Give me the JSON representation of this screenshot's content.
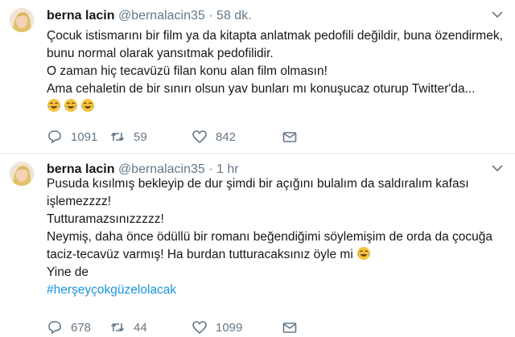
{
  "tweets": [
    {
      "name": "berna lacin",
      "handle": "@bernalacin35",
      "dot": "·",
      "time": "58 dk.",
      "lines": [
        "Çocuk istismarını bir film ya da kitapta anlatmak pedofili değildir, buna özendirmek,",
        "bunu normal olarak yansıtmak pedofilidir.",
        "O zaman hiç tecavüzü filan konu alan film olmasın!",
        "Ama cehaletin de bir sınırı olsun yav bunları mı konuşucaz oturup Twitter'da..."
      ],
      "emoji_count": 3,
      "emoji_name": "laughing-tears-emoji",
      "replies": "1091",
      "retweets": "59",
      "likes": "842"
    },
    {
      "name": "berna lacin",
      "handle": "@bernalacin35",
      "dot": "·",
      "time": "1 hr",
      "lines": [
        "Pusuda kısılmış  bekleyip de dur şimdi bir açığını bulalım da saldıralım kafası",
        "işlemezzzz!",
        "Tutturamazsınızzzzz!",
        "Neymiş, daha önce ödüllü bir romanı beğendiğimi söylemişim de orda da çocuğa",
        "taciz-tecavüz varmış! Ha burdan tutturacaksınız öyle mi",
        "Yine de"
      ],
      "hashtag": "#herşeyçokgüzelolacak",
      "replies": "678",
      "retweets": "44",
      "likes": "1099"
    }
  ],
  "colors": {
    "muted": "#657786",
    "link": "#1b95e0",
    "emoji": "#f7c23b"
  },
  "icons": [
    "avatar",
    "chevron-down-icon",
    "reply-icon",
    "retweet-icon",
    "like-icon",
    "dm-icon"
  ]
}
